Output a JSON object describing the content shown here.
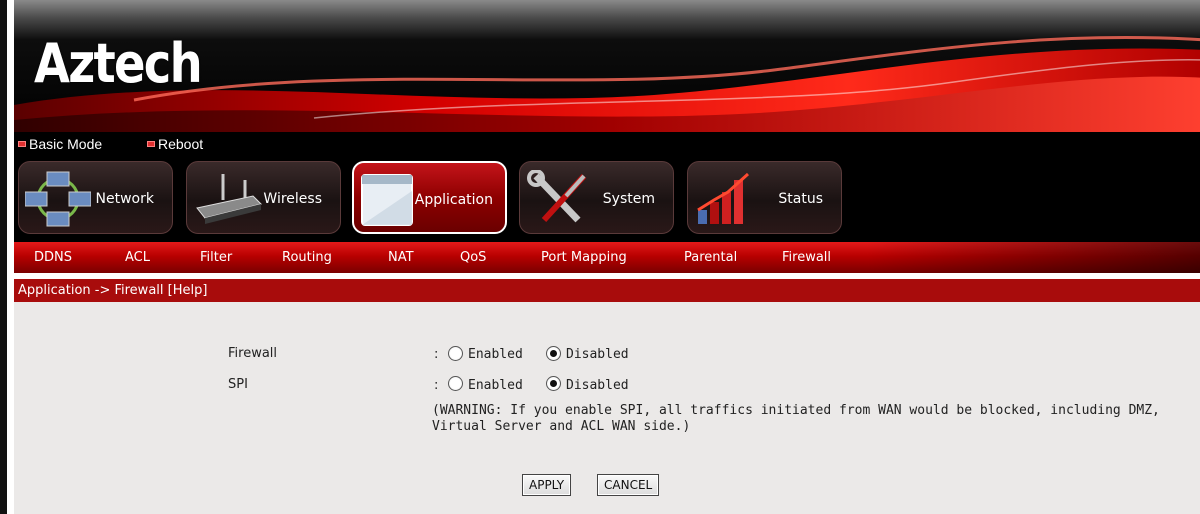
{
  "brand": {
    "logo": "Aztech",
    "accent": "#c40000",
    "accent_dark": "#7a0000"
  },
  "toplinks": [
    {
      "label": "Basic Mode"
    },
    {
      "label": "Reboot"
    }
  ],
  "mainnav": [
    {
      "label": "Network",
      "icon": "network-icon"
    },
    {
      "label": "Wireless",
      "icon": "router-icon"
    },
    {
      "label": "Application",
      "icon": "application-window-icon",
      "active": true
    },
    {
      "label": "System",
      "icon": "tools-icon"
    },
    {
      "label": "Status",
      "icon": "bar-chart-icon"
    }
  ],
  "subnav": [
    {
      "label": "DDNS"
    },
    {
      "label": "ACL"
    },
    {
      "label": "Filter"
    },
    {
      "label": "Routing"
    },
    {
      "label": "NAT"
    },
    {
      "label": "QoS"
    },
    {
      "label": "Port Mapping"
    },
    {
      "label": "Parental"
    },
    {
      "label": "Firewall"
    }
  ],
  "breadcrumb": {
    "path": "Application -> Firewall",
    "help": "[Help]"
  },
  "form": {
    "firewall": {
      "label": "Firewall",
      "colon": ":",
      "enabled_label": "Enabled",
      "disabled_label": "Disabled",
      "selected": "Disabled"
    },
    "spi": {
      "label": "SPI",
      "colon": ":",
      "enabled_label": "Enabled",
      "disabled_label": "Disabled",
      "selected": "Disabled"
    },
    "warning": "(WARNING: If you enable SPI, all traffics initiated from WAN would be blocked, including DMZ, Virtual Server and ACL WAN side.)",
    "apply_label": "APPLY",
    "cancel_label": "CANCEL"
  }
}
